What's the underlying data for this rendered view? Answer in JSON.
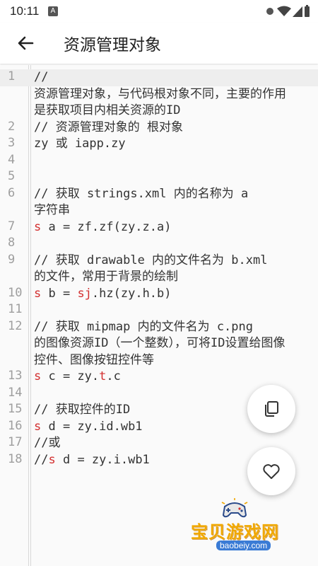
{
  "status": {
    "time": "10:11",
    "notification_icon": "A"
  },
  "appbar": {
    "title": "资源管理对象",
    "back_icon": "arrow-back-icon"
  },
  "code": [
    {
      "n": "1",
      "text": "//"
    },
    {
      "n": "",
      "text": "资源管理对象，与代码根对象不同，主要的作用"
    },
    {
      "n": "",
      "text": "是获取项目内相关资源的ID"
    },
    {
      "n": "2",
      "text": "// 资源管理对象的 根对象"
    },
    {
      "n": "3",
      "text": "zy 或 iapp.zy"
    },
    {
      "n": "4",
      "text": ""
    },
    {
      "n": "5",
      "text": ""
    },
    {
      "n": "6",
      "text": "// 获取 strings.xml 内的名称为 a"
    },
    {
      "n": "",
      "text": "字符串"
    },
    {
      "n": "7",
      "pre": "",
      "kw": "s",
      "rest": " a = zf.zf(zy.z.a)"
    },
    {
      "n": "8",
      "text": ""
    },
    {
      "n": "9",
      "text": "// 获取 drawable 内的文件名为 b.xml"
    },
    {
      "n": "",
      "text": "的文件，常用于背景的绘制"
    },
    {
      "n": "10",
      "pre": "",
      "kw": "s",
      "mid": " b = ",
      "kw2": "sj",
      "rest": ".hz(zy.h.b)"
    },
    {
      "n": "11",
      "text": ""
    },
    {
      "n": "12",
      "text": "// 获取 mipmap 内的文件名为 c.png"
    },
    {
      "n": "",
      "text": "的图像资源ID（一个整数），可将ID设置给图像"
    },
    {
      "n": "",
      "text": "控件、图像按钮控件等"
    },
    {
      "n": "13",
      "pre": "",
      "kw": "s",
      "mid": " c = zy.",
      "kw2": "t",
      "rest": ".c"
    },
    {
      "n": "14",
      "text": ""
    },
    {
      "n": "15",
      "text": "// 获取控件的ID"
    },
    {
      "n": "16",
      "pre": "",
      "kw": "s",
      "rest": " d = zy.id.wb1"
    },
    {
      "n": "17",
      "text": "//或"
    },
    {
      "n": "18",
      "pre": "//",
      "kw": "s",
      "rest": " d = zy.i.wb1"
    }
  ],
  "fabs": {
    "copy_icon": "copy-icon",
    "like_icon": "heart-icon"
  },
  "watermark": {
    "text": "宝贝游戏网",
    "url": "baobeiy.com"
  },
  "colors": {
    "keyword": "#d32f2f",
    "line_numbers": "#9e9e9e",
    "current_line": "#eeeeee"
  }
}
